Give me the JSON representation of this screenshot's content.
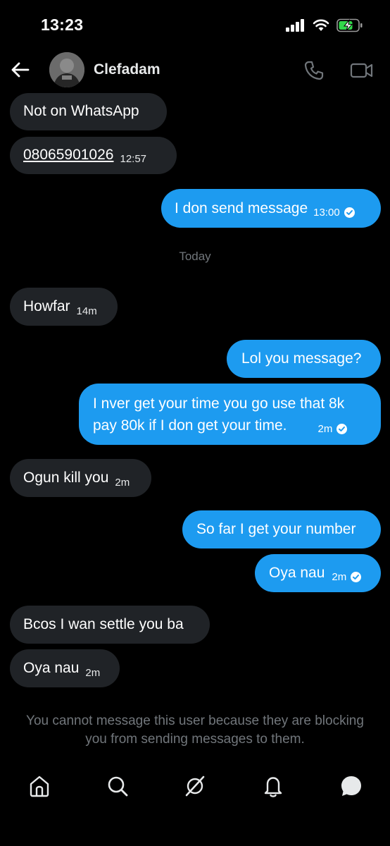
{
  "status_bar": {
    "time": "13:23"
  },
  "header": {
    "contact_name": "Clefadam"
  },
  "messages": [
    {
      "dir": "in",
      "text": "Not on WhatsApp",
      "meta": ""
    },
    {
      "dir": "in",
      "text": "08065901026",
      "meta": "12:57"
    },
    {
      "dir": "out",
      "text": "I don send message",
      "meta": "13:00"
    },
    {
      "dir": "in",
      "text": "Howfar",
      "meta": "14m"
    },
    {
      "dir": "out",
      "text": "Lol you message?",
      "meta": ""
    },
    {
      "dir": "out",
      "line1": "I nver get your time you go use that 8k",
      "line2": "pay 80k if I don get your time.",
      "meta": "2m"
    },
    {
      "dir": "in",
      "text": "Ogun kill you",
      "meta": "2m"
    },
    {
      "dir": "out",
      "text": "So far I get your number",
      "meta": ""
    },
    {
      "dir": "out",
      "text": "Oya nau",
      "meta": "2m"
    },
    {
      "dir": "in",
      "text": "Bcos I wan settle you ba",
      "meta": ""
    },
    {
      "dir": "in",
      "text": "Oya nau",
      "meta": "2m"
    }
  ],
  "day_divider": "Today",
  "blocked_notice": "You cannot message this user because they are blocking you from sending messages to them.",
  "bottom_nav": [
    "home-icon",
    "search-icon",
    "grok-icon",
    "notifications-icon",
    "messages-icon"
  ],
  "colors": {
    "outgoing": "#1d9bf0",
    "incoming": "#202327",
    "background": "#000000",
    "muted": "#71767b"
  }
}
